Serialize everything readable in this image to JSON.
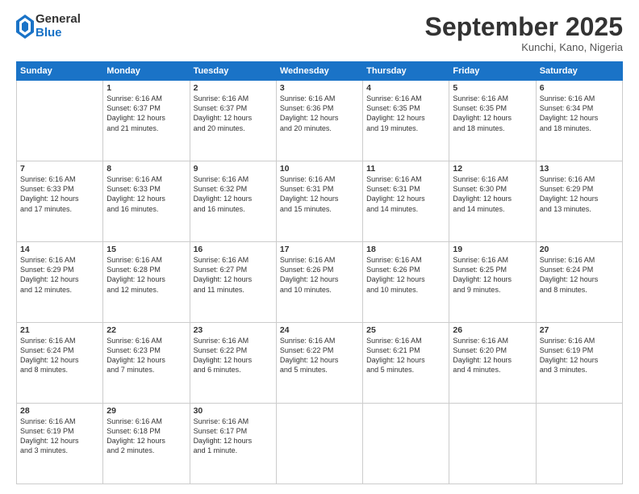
{
  "logo": {
    "general": "General",
    "blue": "Blue"
  },
  "header": {
    "month": "September 2025",
    "location": "Kunchi, Kano, Nigeria"
  },
  "days_of_week": [
    "Sunday",
    "Monday",
    "Tuesday",
    "Wednesday",
    "Thursday",
    "Friday",
    "Saturday"
  ],
  "weeks": [
    [
      {
        "day": "",
        "info": ""
      },
      {
        "day": "1",
        "info": "Sunrise: 6:16 AM\nSunset: 6:37 PM\nDaylight: 12 hours\nand 21 minutes."
      },
      {
        "day": "2",
        "info": "Sunrise: 6:16 AM\nSunset: 6:37 PM\nDaylight: 12 hours\nand 20 minutes."
      },
      {
        "day": "3",
        "info": "Sunrise: 6:16 AM\nSunset: 6:36 PM\nDaylight: 12 hours\nand 20 minutes."
      },
      {
        "day": "4",
        "info": "Sunrise: 6:16 AM\nSunset: 6:35 PM\nDaylight: 12 hours\nand 19 minutes."
      },
      {
        "day": "5",
        "info": "Sunrise: 6:16 AM\nSunset: 6:35 PM\nDaylight: 12 hours\nand 18 minutes."
      },
      {
        "day": "6",
        "info": "Sunrise: 6:16 AM\nSunset: 6:34 PM\nDaylight: 12 hours\nand 18 minutes."
      }
    ],
    [
      {
        "day": "7",
        "info": "Sunrise: 6:16 AM\nSunset: 6:33 PM\nDaylight: 12 hours\nand 17 minutes."
      },
      {
        "day": "8",
        "info": "Sunrise: 6:16 AM\nSunset: 6:33 PM\nDaylight: 12 hours\nand 16 minutes."
      },
      {
        "day": "9",
        "info": "Sunrise: 6:16 AM\nSunset: 6:32 PM\nDaylight: 12 hours\nand 16 minutes."
      },
      {
        "day": "10",
        "info": "Sunrise: 6:16 AM\nSunset: 6:31 PM\nDaylight: 12 hours\nand 15 minutes."
      },
      {
        "day": "11",
        "info": "Sunrise: 6:16 AM\nSunset: 6:31 PM\nDaylight: 12 hours\nand 14 minutes."
      },
      {
        "day": "12",
        "info": "Sunrise: 6:16 AM\nSunset: 6:30 PM\nDaylight: 12 hours\nand 14 minutes."
      },
      {
        "day": "13",
        "info": "Sunrise: 6:16 AM\nSunset: 6:29 PM\nDaylight: 12 hours\nand 13 minutes."
      }
    ],
    [
      {
        "day": "14",
        "info": "Sunrise: 6:16 AM\nSunset: 6:29 PM\nDaylight: 12 hours\nand 12 minutes."
      },
      {
        "day": "15",
        "info": "Sunrise: 6:16 AM\nSunset: 6:28 PM\nDaylight: 12 hours\nand 12 minutes."
      },
      {
        "day": "16",
        "info": "Sunrise: 6:16 AM\nSunset: 6:27 PM\nDaylight: 12 hours\nand 11 minutes."
      },
      {
        "day": "17",
        "info": "Sunrise: 6:16 AM\nSunset: 6:26 PM\nDaylight: 12 hours\nand 10 minutes."
      },
      {
        "day": "18",
        "info": "Sunrise: 6:16 AM\nSunset: 6:26 PM\nDaylight: 12 hours\nand 10 minutes."
      },
      {
        "day": "19",
        "info": "Sunrise: 6:16 AM\nSunset: 6:25 PM\nDaylight: 12 hours\nand 9 minutes."
      },
      {
        "day": "20",
        "info": "Sunrise: 6:16 AM\nSunset: 6:24 PM\nDaylight: 12 hours\nand 8 minutes."
      }
    ],
    [
      {
        "day": "21",
        "info": "Sunrise: 6:16 AM\nSunset: 6:24 PM\nDaylight: 12 hours\nand 8 minutes."
      },
      {
        "day": "22",
        "info": "Sunrise: 6:16 AM\nSunset: 6:23 PM\nDaylight: 12 hours\nand 7 minutes."
      },
      {
        "day": "23",
        "info": "Sunrise: 6:16 AM\nSunset: 6:22 PM\nDaylight: 12 hours\nand 6 minutes."
      },
      {
        "day": "24",
        "info": "Sunrise: 6:16 AM\nSunset: 6:22 PM\nDaylight: 12 hours\nand 5 minutes."
      },
      {
        "day": "25",
        "info": "Sunrise: 6:16 AM\nSunset: 6:21 PM\nDaylight: 12 hours\nand 5 minutes."
      },
      {
        "day": "26",
        "info": "Sunrise: 6:16 AM\nSunset: 6:20 PM\nDaylight: 12 hours\nand 4 minutes."
      },
      {
        "day": "27",
        "info": "Sunrise: 6:16 AM\nSunset: 6:19 PM\nDaylight: 12 hours\nand 3 minutes."
      }
    ],
    [
      {
        "day": "28",
        "info": "Sunrise: 6:16 AM\nSunset: 6:19 PM\nDaylight: 12 hours\nand 3 minutes."
      },
      {
        "day": "29",
        "info": "Sunrise: 6:16 AM\nSunset: 6:18 PM\nDaylight: 12 hours\nand 2 minutes."
      },
      {
        "day": "30",
        "info": "Sunrise: 6:16 AM\nSunset: 6:17 PM\nDaylight: 12 hours\nand 1 minute."
      },
      {
        "day": "",
        "info": ""
      },
      {
        "day": "",
        "info": ""
      },
      {
        "day": "",
        "info": ""
      },
      {
        "day": "",
        "info": ""
      }
    ]
  ]
}
